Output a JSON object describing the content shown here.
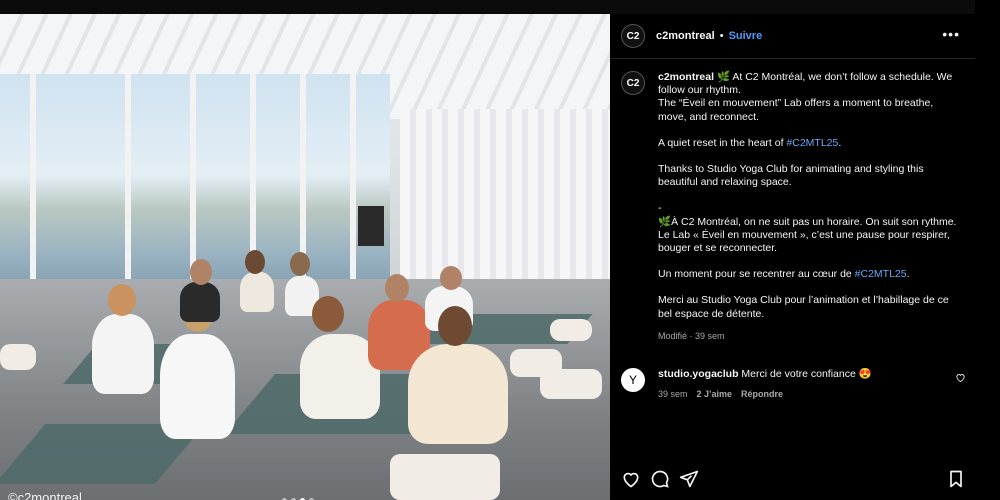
{
  "post": {
    "watermark": "©c2montreal",
    "carousel": {
      "count": 4,
      "active_index": 2
    }
  },
  "header": {
    "avatar_text": "C2",
    "username": "c2montreal",
    "separator": "•",
    "follow_label": "Suivre",
    "more_label": "•••"
  },
  "caption": {
    "username": "c2montreal",
    "line1_text": " 🌿 At C2 Montréal, we don’t follow a schedule. We follow our rhythm.",
    "line2_text": "The “Éveil en mouvement” Lab offers a moment to breathe, move, and reconnect.",
    "line3_prefix": "A quiet reset in the heart of ",
    "line3_tag": "#C2MTL25",
    "line3_suffix": ".",
    "line4_text": "Thanks to Studio Yoga Club for animating and styling this beautiful and relaxing space.",
    "dash": "-",
    "fr1_text": "🌿À C2 Montréal, on ne suit pas un horaire. On suit son rythme.",
    "fr2_text": "Le Lab « Éveil en mouvement », c’est une pause pour respirer, bouger et se reconnecter.",
    "fr3_prefix": "Un moment pour se recentrer au cœur de ",
    "fr3_tag": "#C2MTL25",
    "fr3_suffix": ".",
    "fr4_text": "Merci au Studio Yoga Club pour l’animation et l’habillage de ce bel espace de détente.",
    "meta": "Modifié · 39 sem"
  },
  "comment": {
    "avatar_glyph": "Y",
    "username": "studio.yogaclub",
    "text": " Merci de votre confiance 😍",
    "time": "39 sem",
    "likes": "2 J’aime",
    "reply_label": "Répondre"
  },
  "colors": {
    "link": "#4f9bf5",
    "hashtag": "#6aa8f7",
    "background": "#000000"
  },
  "icons": [
    "heart-icon",
    "comment-icon",
    "share-icon",
    "bookmark-icon",
    "more-icon"
  ]
}
